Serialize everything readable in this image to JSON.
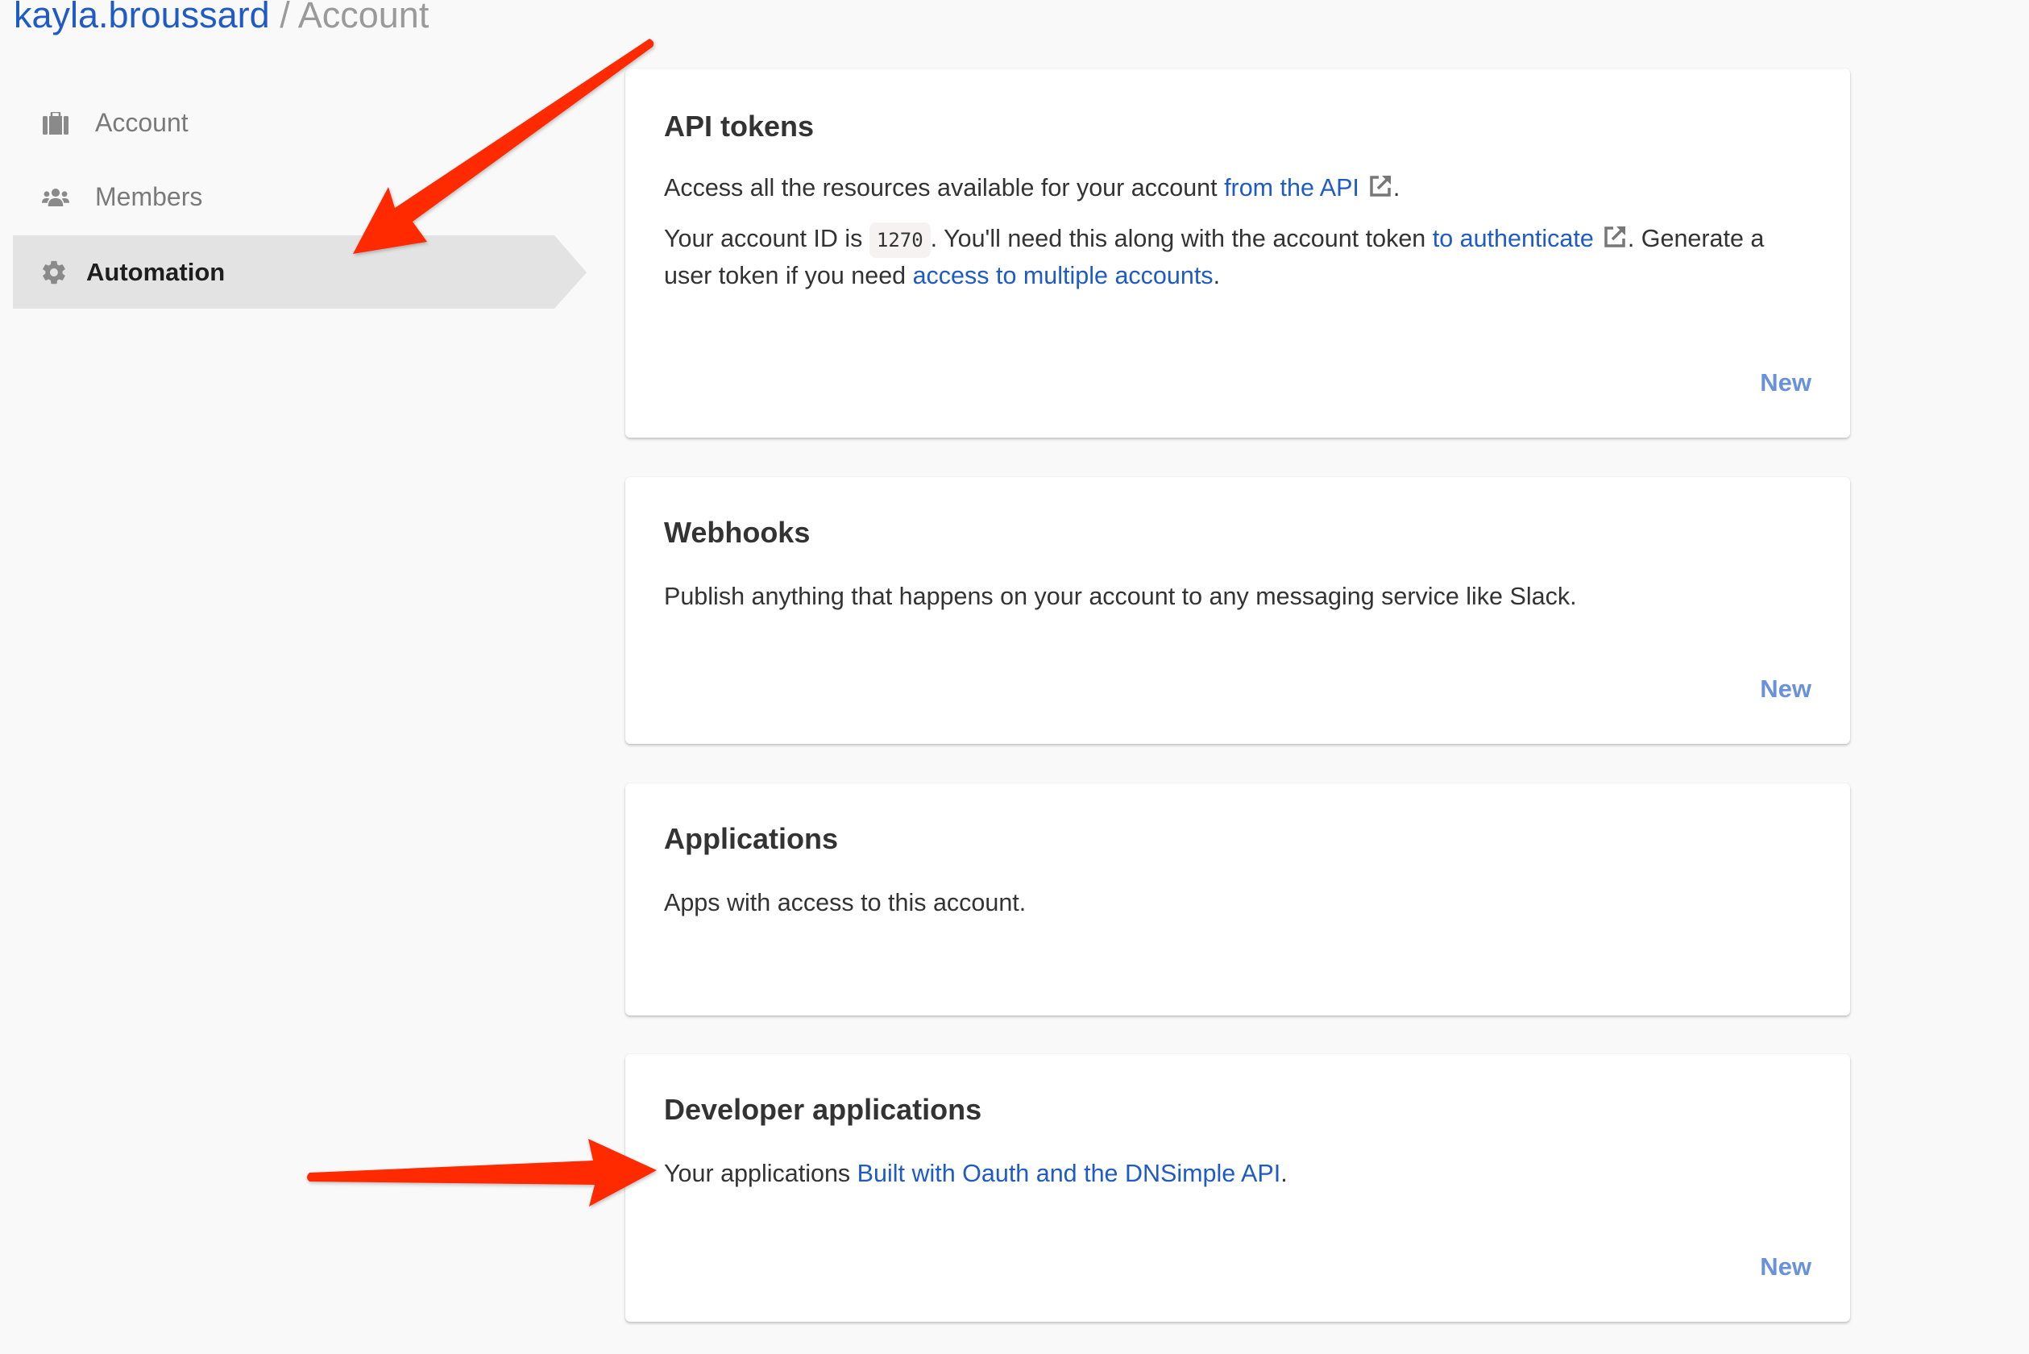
{
  "breadcrumb": {
    "user": "kayla.broussard",
    "separator": "/",
    "current": "Account"
  },
  "sidebar": {
    "items": [
      {
        "label": "Account",
        "icon": "briefcase-icon",
        "active": false
      },
      {
        "label": "Members",
        "icon": "users-icon",
        "active": false
      },
      {
        "label": "Automation",
        "icon": "gear-icon",
        "active": true
      }
    ]
  },
  "cards": {
    "api_tokens": {
      "title": "API tokens",
      "p1_text": "Access all the resources available for your account ",
      "p1_link": "from the API",
      "p1_end": ".",
      "p2_a": "Your account ID is ",
      "account_id": "1270",
      "p2_b": ". You'll need this along with the account token ",
      "p2_link1": "to authenticate",
      "p2_c": ". Generate a user token if you need ",
      "p2_link2": "access to multiple accounts",
      "p2_end": ".",
      "new_label": "New"
    },
    "webhooks": {
      "title": "Webhooks",
      "body": "Publish anything that happens on your account to any messaging service like Slack.",
      "new_label": "New"
    },
    "applications": {
      "title": "Applications",
      "body": "Apps with access to this account."
    },
    "developer_applications": {
      "title": "Developer applications",
      "body_text": "Your applications ",
      "body_link": "Built with Oauth and the DNSimple API",
      "body_end": ".",
      "new_label": "New"
    }
  },
  "colors": {
    "link": "#1f5bc7",
    "new_button": "#6a92db",
    "active_nav_bg": "#e3e3e3",
    "annotation_arrow": "#ff2a00",
    "page_bg": "#f9f9f9"
  }
}
